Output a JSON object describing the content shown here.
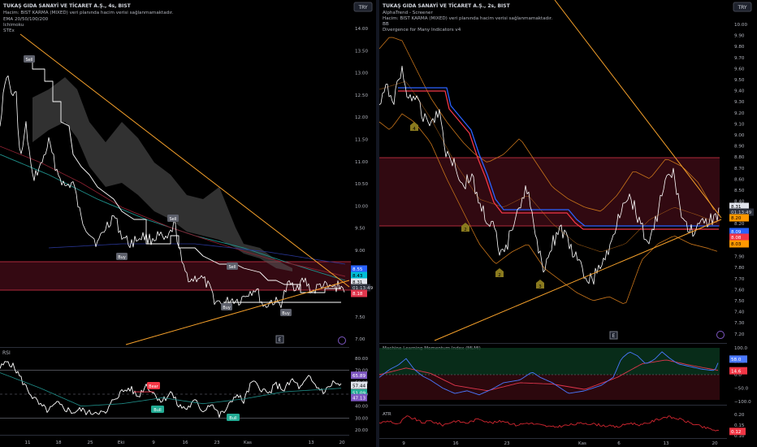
{
  "left_chart": {
    "title": "TUKAŞ GIDA SANAYİ VE TİCARET A.Ş., 4s, BIST",
    "legend": [
      "Hacim: BIST KARMA (MIXED) veri planında hacim verisi sağlanmamaktadır.",
      "EMA 20/50/100/200",
      "Ichimoku",
      "STEx"
    ],
    "currency_badge": "TRY",
    "y_ticks": [
      "14.00",
      "13.50",
      "13.00",
      "12.50",
      "12.00",
      "11.50",
      "11.00",
      "10.50",
      "10.00",
      "9.50",
      "9.00",
      "8.50",
      "8.00",
      "7.50",
      "7.00"
    ],
    "price_tags": [
      "8.55",
      "8.43",
      "8.31",
      "01:13:49",
      "8.18"
    ],
    "signals": [
      "Sell",
      "Buy",
      "Sell",
      "Sell",
      "Buy",
      "Buy"
    ],
    "event_marker": "E",
    "x_labels": [
      "11",
      "18",
      "25",
      "Eki",
      "9",
      "16",
      "23",
      "Kas",
      "13",
      "20"
    ],
    "rsi": {
      "title": "RSI",
      "y_ticks": [
        "80.00",
        "70.00",
        "60.00",
        "50.00",
        "40.00",
        "30.00",
        "20.00"
      ],
      "value_tags": [
        "65.89",
        "57.44",
        "51.09",
        "47.13"
      ],
      "signals": [
        "Bear",
        "Bull",
        "Bull"
      ]
    }
  },
  "right_chart": {
    "title": "TUKAŞ GIDA SANAYİ VE TİCARET A.Ş., 2s, BIST",
    "legend": [
      "AlphaTrend - Screener",
      "Hacim: BIST KARMA (MIXED) veri planında hacim verisi sağlanmamaktadır.",
      "BB",
      "Divergence for Many Indicators v4"
    ],
    "currency_badge": "TRY",
    "y_ticks": [
      "10.00",
      "9.90",
      "9.80",
      "9.70",
      "9.60",
      "9.50",
      "9.40",
      "9.30",
      "9.20",
      "9.10",
      "9.00",
      "8.90",
      "8.80",
      "8.70",
      "8.60",
      "8.50",
      "8.40",
      "8.30",
      "8.20",
      "8.10",
      "8.00",
      "7.90",
      "7.80",
      "7.70",
      "7.60",
      "7.50",
      "7.40",
      "7.30",
      "7.20"
    ],
    "price_tags": [
      "8.31",
      "01:13:49",
      "8.20",
      "8.09",
      "8.08",
      "8.03"
    ],
    "markers": [
      "4",
      "2",
      "2",
      "3"
    ],
    "event_marker": "E",
    "x_labels": [
      "9",
      "16",
      "23",
      "Kas",
      "6",
      "13",
      "20"
    ],
    "mlmi": {
      "title": "Machine Learning Momentum Index (MLMI)",
      "y_ticks": [
        "100.0",
        "50.0",
        "0.0",
        "−50.0",
        "−100.0"
      ],
      "value_tags": [
        "58.0",
        "14.6"
      ]
    },
    "atr": {
      "title": "ATR",
      "y_ticks": [
        "0.20",
        "0.15",
        "0.10"
      ],
      "value_tags": [
        "0.12"
      ]
    }
  },
  "colors": {
    "background": "#000000",
    "price": "#ffffff",
    "trendline": "#f5a02a",
    "zone_fill": "#3a0a14",
    "zone_border": "#e0364d",
    "cloud": "#5a5a5a",
    "ema_teal": "#1f8f8a",
    "ema_red": "#8a2030",
    "rsi_line": "#ffffff",
    "mlmi_blue": "#4a78ff",
    "mlmi_red": "#e0364d",
    "atr_red": "#d22630",
    "bb_orange": "#c8741a"
  }
}
